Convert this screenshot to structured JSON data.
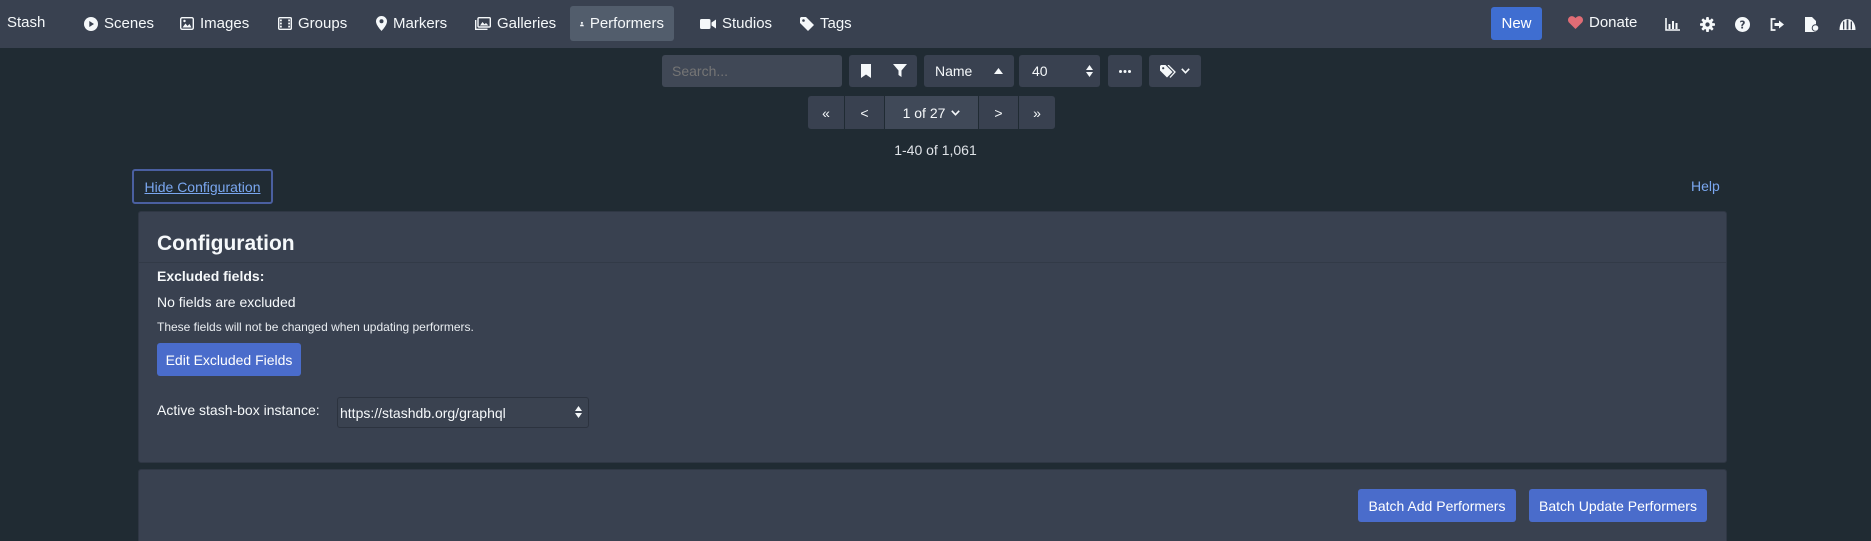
{
  "nav": {
    "brand": "Stash",
    "items": [
      {
        "label": "Scenes",
        "icon": "play-circle-icon"
      },
      {
        "label": "Images",
        "icon": "image-icon"
      },
      {
        "label": "Groups",
        "icon": "film-icon"
      },
      {
        "label": "Markers",
        "icon": "map-marker-icon"
      },
      {
        "label": "Galleries",
        "icon": "images-icon"
      },
      {
        "label": "Performers",
        "icon": "user-icon"
      },
      {
        "label": "Studios",
        "icon": "video-icon"
      },
      {
        "label": "Tags",
        "icon": "tag-icon"
      }
    ],
    "active": "Performers",
    "new_label": "New",
    "donate_label": "Donate",
    "right_icons": [
      "stats-icon",
      "gear-icon",
      "help-icon",
      "logout-icon",
      "file-icon",
      "helmet-icon"
    ]
  },
  "toolbar": {
    "search_placeholder": "Search...",
    "sort_label": "Name",
    "per_page": "40"
  },
  "pager": {
    "first": "«",
    "prev": "<",
    "current": "1 of 27",
    "next": ">",
    "last": "»"
  },
  "count_text": "1-40 of 1,061",
  "config": {
    "hide_label": "Hide Configuration",
    "help_label": "Help",
    "title": "Configuration",
    "excluded_label": "Excluded fields:",
    "no_fields": "No fields are excluded",
    "note": "These fields will not be changed when updating performers.",
    "edit_button": "Edit Excluded Fields",
    "instance_label": "Active stash-box instance:",
    "instance_value": "https://stashdb.org/graphql"
  },
  "batch": {
    "add_label": "Batch Add Performers",
    "update_label": "Batch Update Performers"
  },
  "colors": {
    "navbar": "#394150",
    "background": "#202b33",
    "primary": "#3f6ed1",
    "heart": "#e06c75"
  }
}
